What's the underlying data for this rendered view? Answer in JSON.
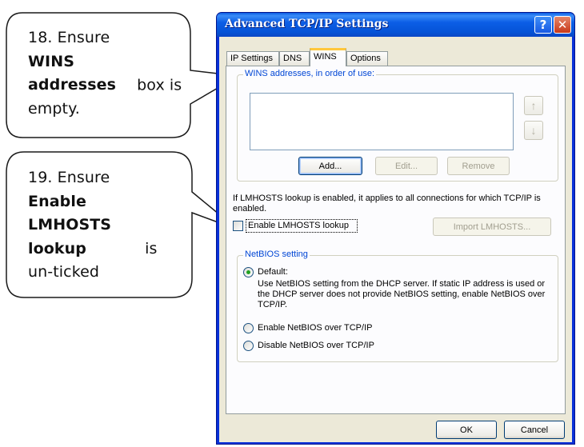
{
  "callouts": [
    {
      "step": "18. Ensure",
      "bold": "WINS addresses",
      "rest": "box is empty.",
      "lines": [
        [
          "18. Ensure",
          ""
        ],
        [
          "",
          "WINS"
        ],
        [
          "",
          "addresses",
          " box"
        ],
        [
          "is empty.",
          ""
        ]
      ]
    },
    {
      "step": "19. Ensure",
      "bold": "Enable LMHOSTS lookup",
      "rest": "is un-ticked"
    }
  ],
  "window": {
    "title": "Advanced TCP/IP Settings",
    "help_label": "?",
    "close_label": "✕"
  },
  "tabs": [
    {
      "label": "IP Settings",
      "active": false
    },
    {
      "label": "DNS",
      "active": false
    },
    {
      "label": "WINS",
      "active": true
    },
    {
      "label": "Options",
      "active": false
    }
  ],
  "wins": {
    "group_label": "WINS addresses, in order of use:",
    "up_icon": "arrow-up-icon",
    "down_icon": "arrow-down-icon",
    "add_label": "Add...",
    "edit_label": "Edit...",
    "remove_label": "Remove"
  },
  "lmhosts": {
    "info": "If LMHOSTS lookup is enabled, it applies to all connections for which TCP/IP is enabled.",
    "checkbox_label": "Enable LMHOSTS lookup",
    "checked": false,
    "import_label": "Import LMHOSTS..."
  },
  "netbios": {
    "group_label": "NetBIOS setting",
    "default_label": "Default:",
    "default_desc": "Use NetBIOS setting from the DHCP server. If static IP address is used or the DHCP server does not provide NetBIOS setting, enable NetBIOS over TCP/IP.",
    "enable_label": "Enable NetBIOS over TCP/IP",
    "disable_label": "Disable NetBIOS over TCP/IP",
    "selected": "Default"
  },
  "footer": {
    "ok_label": "OK",
    "cancel_label": "Cancel"
  },
  "colors": {
    "titlebar": "#0553d7",
    "dialog_bg": "#ece9d8",
    "group_label": "#0046d5",
    "active_tab_accent": "#ffc73c"
  }
}
